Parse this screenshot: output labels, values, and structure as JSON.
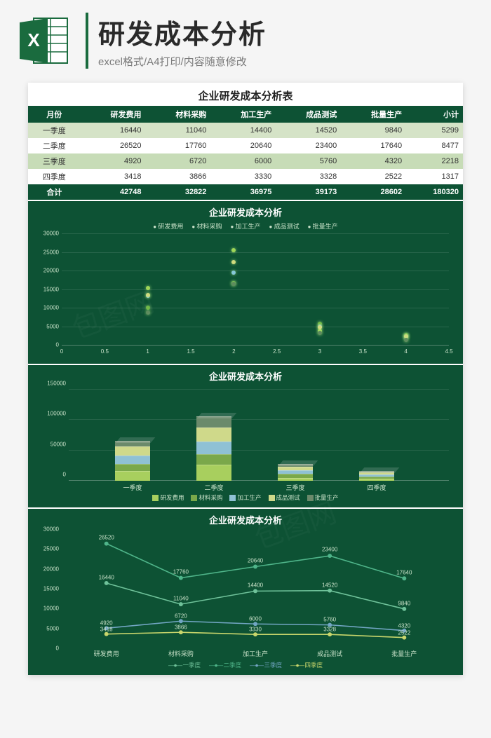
{
  "header": {
    "main_title": "研发成本分析",
    "subtitle": "excel格式/A4打印/内容随意修改",
    "logo_alt": "Excel"
  },
  "sheet_title": "企业研发成本分析表",
  "columns": [
    "月份",
    "研发费用",
    "材料采购",
    "加工生产",
    "成品测试",
    "批量生产",
    "小计"
  ],
  "rows": [
    {
      "label": "一季度",
      "v": [
        16440,
        11040,
        14400,
        14520,
        9840,
        5299
      ]
    },
    {
      "label": "二季度",
      "v": [
        26520,
        17760,
        20640,
        23400,
        17640,
        8477
      ]
    },
    {
      "label": "三季度",
      "v": [
        4920,
        6720,
        6000,
        5760,
        4320,
        2218
      ]
    },
    {
      "label": "四季度",
      "v": [
        3418,
        3866,
        3330,
        3328,
        2522,
        1317
      ]
    }
  ],
  "total": {
    "label": "合计",
    "v": [
      42748,
      32822,
      36975,
      39173,
      28602,
      180320
    ]
  },
  "chart_data": [
    {
      "type": "scatter",
      "title": "企业研发成本分析",
      "legend": [
        "研发费用",
        "材料采购",
        "加工生产",
        "成品测试",
        "批量生产"
      ],
      "x": [
        1,
        2,
        3,
        4
      ],
      "series": [
        {
          "name": "研发费用",
          "values": [
            16440,
            26520,
            4920,
            3418
          ]
        },
        {
          "name": "材料采购",
          "values": [
            11040,
            17760,
            6720,
            3866
          ]
        },
        {
          "name": "加工生产",
          "values": [
            14400,
            20640,
            6000,
            3330
          ]
        },
        {
          "name": "成品测试",
          "values": [
            14520,
            23400,
            5760,
            3328
          ]
        },
        {
          "name": "批量生产",
          "values": [
            9840,
            17640,
            4320,
            2522
          ]
        }
      ],
      "xlim": [
        0,
        4.5
      ],
      "ylim": [
        0,
        30000
      ],
      "xticks": [
        0,
        0.5,
        1,
        1.5,
        2,
        2.5,
        3,
        3.5,
        4,
        4.5
      ],
      "yticks": [
        0,
        5000,
        10000,
        15000,
        20000,
        25000,
        30000
      ]
    },
    {
      "type": "bar",
      "title": "企业研发成本分析",
      "stacked": true,
      "categories": [
        "一季度",
        "二季度",
        "三季度",
        "四季度"
      ],
      "series": [
        {
          "name": "研发费用",
          "values": [
            16440,
            26520,
            4920,
            3418
          ],
          "color": "#a8cf5e"
        },
        {
          "name": "材料采购",
          "values": [
            11040,
            17760,
            6720,
            3866
          ],
          "color": "#7aa84a"
        },
        {
          "name": "加工生产",
          "values": [
            14400,
            20640,
            6000,
            3330
          ],
          "color": "#8fc1d4"
        },
        {
          "name": "成品测试",
          "values": [
            14520,
            23400,
            5760,
            3328
          ],
          "color": "#cfd98a"
        },
        {
          "name": "批量生产",
          "values": [
            9840,
            17640,
            4320,
            2522
          ],
          "color": "#6b8a6b"
        }
      ],
      "ylim": [
        0,
        150000
      ],
      "yticks": [
        0,
        50000,
        100000,
        150000
      ]
    },
    {
      "type": "line",
      "title": "企业研发成本分析",
      "categories": [
        "研发费用",
        "材料采购",
        "加工生产",
        "成品测试",
        "批量生产"
      ],
      "series": [
        {
          "name": "一季度",
          "values": [
            16440,
            11040,
            14400,
            14520,
            9840
          ],
          "color": "#6fc29a"
        },
        {
          "name": "二季度",
          "values": [
            26520,
            17760,
            20640,
            23400,
            17640
          ],
          "color": "#4fb58a"
        },
        {
          "name": "三季度",
          "values": [
            4920,
            6720,
            6000,
            5760,
            4320
          ],
          "color": "#72a6c4"
        },
        {
          "name": "四季度",
          "values": [
            3418,
            3866,
            3330,
            3328,
            2522
          ],
          "color": "#c9d66c"
        }
      ],
      "ylim": [
        0,
        30000
      ],
      "yticks": [
        0,
        5000,
        10000,
        15000,
        20000,
        25000,
        30000
      ]
    }
  ]
}
